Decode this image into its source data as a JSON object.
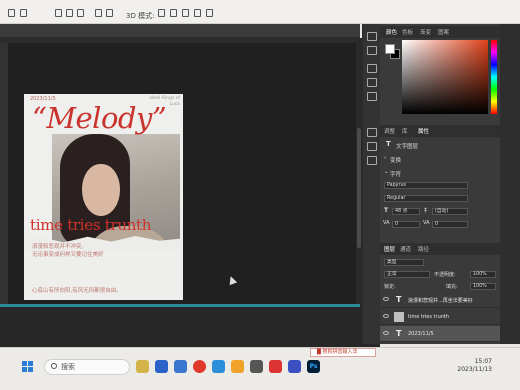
{
  "toolbar": {
    "mode_label": "3D 模式:"
  },
  "poster": {
    "date": "2023/11/5",
    "title": "“Melody”",
    "subtitle_right": "Ideal Rings of Luck",
    "headline": "time tries trunth",
    "cn_line1": "浪漫和悲观并不冲突,",
    "cn_line2": "无论事变成何样又要记住美好",
    "cn_line3": "心底山有所向阳,有风无风都很自由。"
  },
  "color_panel": {
    "tabs": [
      "颜色",
      "色板",
      "渐变",
      "图案"
    ]
  },
  "properties_panel": {
    "tabs": [
      "调整",
      "库",
      "属性"
    ],
    "section_text_layer": "文字图层",
    "section_transform": "变换",
    "section_character": "字符",
    "font_family": "Papyrus",
    "font_style": "Regular",
    "font_size": "48 点",
    "leading": "(自动)",
    "tracking": "0",
    "kerning": "0"
  },
  "layers_panel": {
    "tabs": [
      "图层",
      "通道",
      "路径"
    ],
    "filter_kind": "类型",
    "blend_mode": "正常",
    "opacity_label": "不透明度:",
    "opacity": "100%",
    "lock_label": "锁定:",
    "fill_label": "填充:",
    "fill": "100%",
    "layers": [
      {
        "name": "浪漫和悲观并...再坐法要美好",
        "type": "text"
      },
      {
        "name": "time tries trunth",
        "type": "image"
      },
      {
        "name": "2023/11/5",
        "type": "text"
      }
    ]
  },
  "taskbar": {
    "search_placeholder": "搜索",
    "ime_label": "█ 搜狗拼音输入法",
    "time": "15:07",
    "date": "2023/11/13"
  },
  "colors": {
    "accent_red": "#d0302b",
    "panel_bg": "#3a3a3a",
    "canvas_bg": "#202020"
  }
}
